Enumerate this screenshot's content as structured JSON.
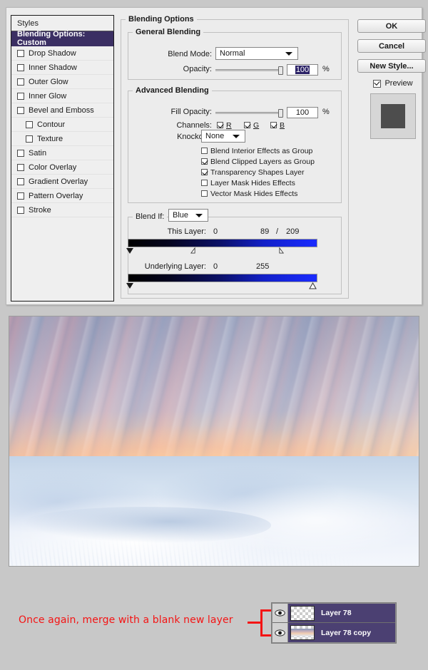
{
  "dialog": {
    "styles_panel": {
      "header": "Styles",
      "items": [
        {
          "label": "Blending Options: Custom",
          "selected": true,
          "checkbox": false,
          "sub": false
        },
        {
          "label": "Drop Shadow",
          "selected": false,
          "checkbox": true,
          "checked": false,
          "sub": false
        },
        {
          "label": "Inner Shadow",
          "selected": false,
          "checkbox": true,
          "checked": false,
          "sub": false
        },
        {
          "label": "Outer Glow",
          "selected": false,
          "checkbox": true,
          "checked": false,
          "sub": false
        },
        {
          "label": "Inner Glow",
          "selected": false,
          "checkbox": true,
          "checked": false,
          "sub": false
        },
        {
          "label": "Bevel and Emboss",
          "selected": false,
          "checkbox": true,
          "checked": false,
          "sub": false
        },
        {
          "label": "Contour",
          "selected": false,
          "checkbox": true,
          "checked": false,
          "sub": true
        },
        {
          "label": "Texture",
          "selected": false,
          "checkbox": true,
          "checked": false,
          "sub": true
        },
        {
          "label": "Satin",
          "selected": false,
          "checkbox": true,
          "checked": false,
          "sub": false
        },
        {
          "label": "Color Overlay",
          "selected": false,
          "checkbox": true,
          "checked": false,
          "sub": false
        },
        {
          "label": "Gradient Overlay",
          "selected": false,
          "checkbox": true,
          "checked": false,
          "sub": false
        },
        {
          "label": "Pattern Overlay",
          "selected": false,
          "checkbox": true,
          "checked": false,
          "sub": false
        },
        {
          "label": "Stroke",
          "selected": false,
          "checkbox": true,
          "checked": false,
          "sub": false
        }
      ]
    },
    "blending_options": {
      "group_title": "Blending Options",
      "general_blending": {
        "title": "General Blending",
        "blend_mode_label": "Blend Mode:",
        "blend_mode_value": "Normal",
        "opacity_label": "Opacity:",
        "opacity_value": "100",
        "opacity_unit": "%",
        "opacity_slider_percent": 100
      },
      "advanced_blending": {
        "title": "Advanced Blending",
        "fill_opacity_label": "Fill Opacity:",
        "fill_opacity_value": "100",
        "fill_opacity_unit": "%",
        "fill_opacity_slider_percent": 100,
        "channels_label": "Channels:",
        "channels": [
          {
            "label": "R",
            "checked": true
          },
          {
            "label": "G",
            "checked": true
          },
          {
            "label": "B",
            "checked": true
          }
        ],
        "knockout_label": "Knockout:",
        "knockout_value": "None",
        "options": [
          {
            "label": "Blend Interior Effects as Group",
            "checked": false
          },
          {
            "label": "Blend Clipped Layers as Group",
            "checked": true
          },
          {
            "label": "Transparency Shapes Layer",
            "checked": true
          },
          {
            "label": "Layer Mask Hides Effects",
            "checked": false
          },
          {
            "label": "Vector Mask Hides Effects",
            "checked": false
          }
        ]
      },
      "blend_if": {
        "label": "Blend If:",
        "channel_value": "Blue",
        "this_layer": {
          "label": "This Layer:",
          "black_value": "0",
          "white_low": "89",
          "separator": "/",
          "white_high": "209",
          "black_knob_percent": 0,
          "white_low_percent": 35,
          "white_high_percent": 82
        },
        "underlying_layer": {
          "label": "Underlying Layer:",
          "black_value": "0",
          "white_value": "255",
          "black_knob_percent": 0,
          "white_knob_percent": 100
        }
      }
    },
    "buttons": {
      "ok": "OK",
      "cancel": "Cancel",
      "new_style": "New Style...",
      "preview_label": "Preview",
      "preview_checked": true
    }
  },
  "annotation": {
    "text": "Once again, merge with a blank new layer",
    "color": "#f41414"
  },
  "layers_panel": {
    "rows": [
      {
        "name": "Layer 78",
        "visible": true,
        "thumb_type": "empty"
      },
      {
        "name": "Layer 78 copy",
        "visible": true,
        "thumb_type": "image"
      }
    ],
    "row_color": "#4b4072"
  }
}
